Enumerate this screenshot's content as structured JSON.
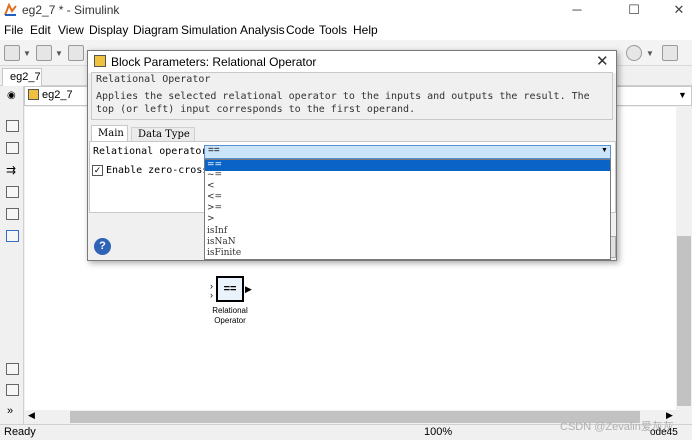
{
  "window": {
    "title": "eg2_7 * - Simulink",
    "controls": {
      "minimize": "─",
      "maximize": "☐",
      "close": "✕"
    }
  },
  "menu": [
    "File",
    "Edit",
    "View",
    "Display",
    "Diagram",
    "Simulation",
    "Analysis",
    "Code",
    "Tools",
    "Help"
  ],
  "model_tab": "eg2_7",
  "address": "eg2_7",
  "canvas_block": {
    "glyph": "==",
    "label_line1": "Relational",
    "label_line2": "Operator"
  },
  "status": {
    "ready": "Ready",
    "zoom": "100%",
    "solver": "ode45"
  },
  "watermark": "CSDN @Zevalin爱灰灰",
  "dialog": {
    "title": "Block Parameters: Relational Operator",
    "block_name": "Relational Operator",
    "description": "Applies the selected relational operator to the inputs and outputs the result. The top (or left) input corresponds to the first operand.",
    "tabs": [
      "Main",
      "Data Type"
    ],
    "relational_label": "Relational operator:",
    "relational_value": "==",
    "zero_crossing_label": "Enable zero-crossing detection",
    "zero_crossing_checked": true,
    "help_glyph": "?",
    "close_glyph": "✕"
  },
  "dropdown_options": [
    "==",
    "~=",
    "<",
    "<=",
    ">=",
    ">",
    "isInf",
    "isNaN",
    "isFinite"
  ],
  "dropdown_selected": 0
}
